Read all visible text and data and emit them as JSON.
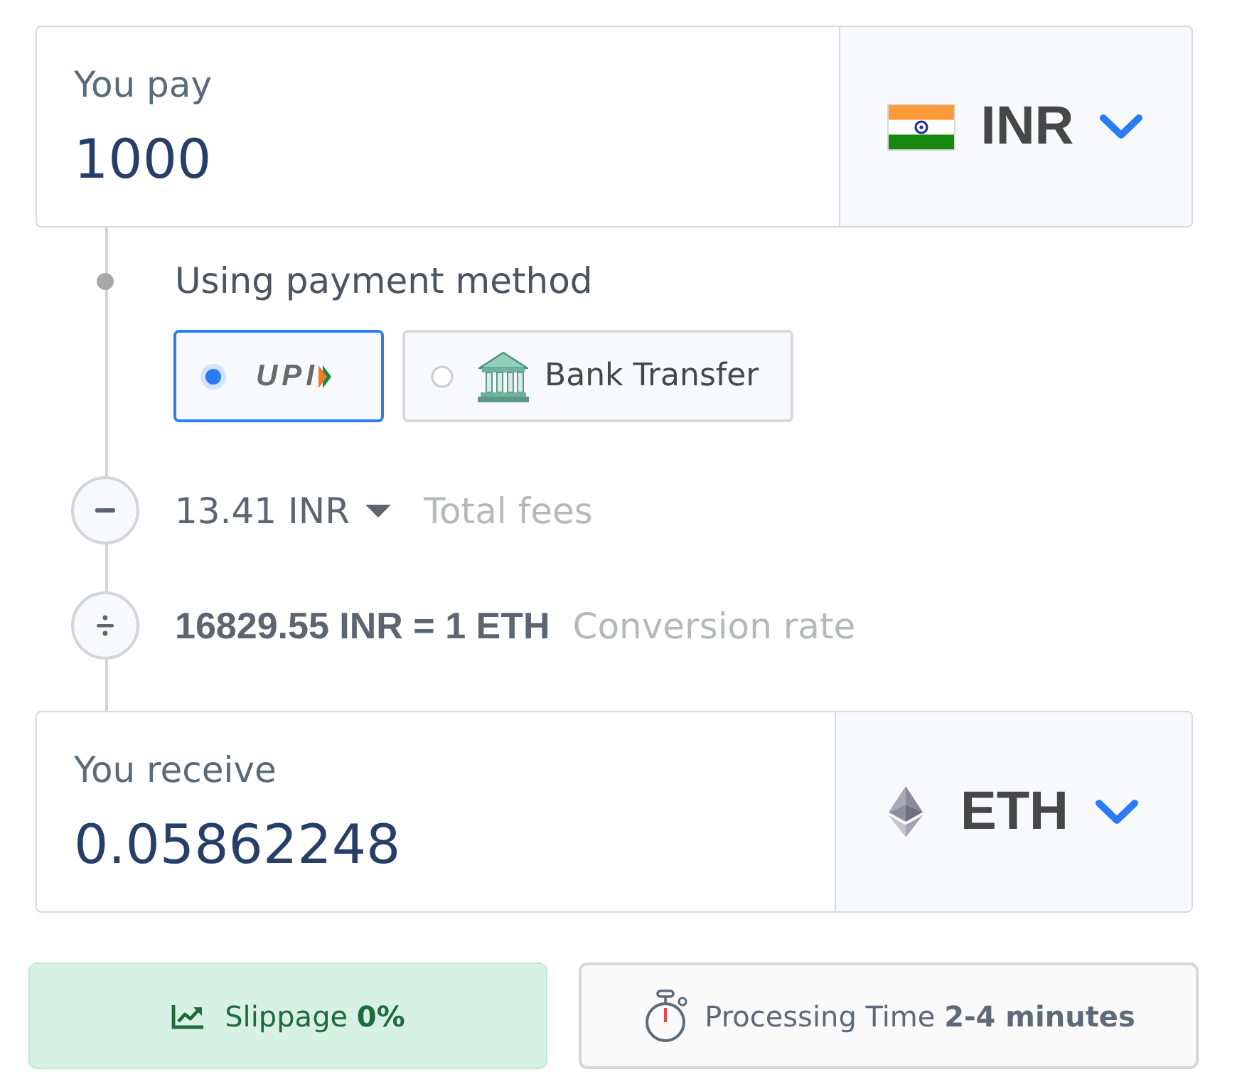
{
  "pay": {
    "label": "You pay",
    "amount": "1000",
    "currency": "INR"
  },
  "payment_method": {
    "label": "Using payment method",
    "options": [
      {
        "kind": "upi",
        "label": "UPI",
        "selected": true
      },
      {
        "kind": "bank",
        "label": "Bank Transfer",
        "selected": false
      }
    ]
  },
  "fees": {
    "amount": "13.41 INR",
    "label": "Total fees"
  },
  "conversion": {
    "rate": "16829.55 INR = 1 ETH",
    "label": "Conversion rate"
  },
  "receive": {
    "label": "You receive",
    "amount": "0.05862248",
    "currency": "ETH"
  },
  "info": [
    {
      "kind": "slippage",
      "text": "Slippage **0%**"
    },
    {
      "kind": "processing",
      "text": "Processing Time **2-4 minutes**"
    }
  ]
}
